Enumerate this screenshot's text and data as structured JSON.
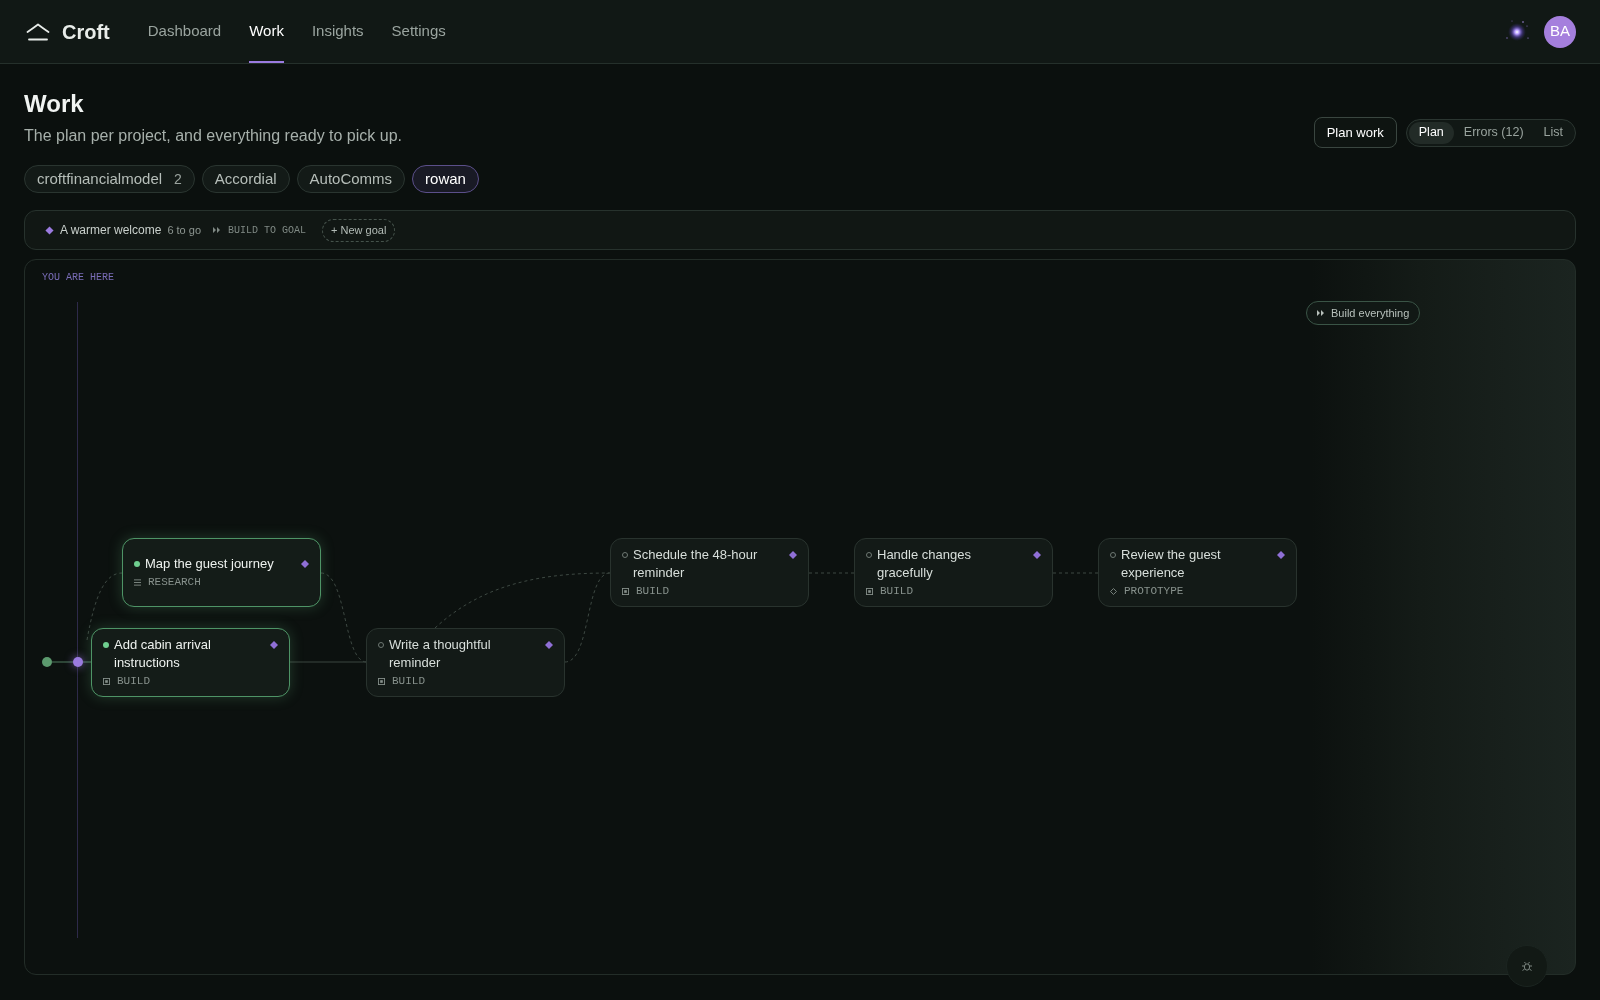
{
  "app": {
    "name": "Croft"
  },
  "nav": [
    {
      "label": "Dashboard",
      "selected": false
    },
    {
      "label": "Work",
      "selected": true
    },
    {
      "label": "Insights",
      "selected": false
    },
    {
      "label": "Settings",
      "selected": false
    }
  ],
  "user": {
    "initials": "BA"
  },
  "page": {
    "title": "Work",
    "subtitle": "The plan per project, and everything ready to pick up."
  },
  "actions": {
    "plan_button": "Plan work",
    "views": [
      {
        "label": "Plan",
        "selected": true
      },
      {
        "label": "Errors (12)",
        "selected": false
      },
      {
        "label": "List",
        "selected": false
      }
    ]
  },
  "projects": [
    {
      "name": "croftfinancialmodel",
      "count": "2",
      "selected": false
    },
    {
      "name": "Accordial",
      "selected": false
    },
    {
      "name": "AutoComms",
      "selected": false
    },
    {
      "name": "rowan",
      "selected": true
    }
  ],
  "goal_bar": {
    "goal": "A warmer welcome",
    "remaining": "6 to go",
    "build_action": "BUILD TO GOAL",
    "new_goal": "+ New goal"
  },
  "canvas": {
    "marker_label": "YOU ARE HERE",
    "build_all": "Build everything",
    "nodes": [
      {
        "title": "Map the guest journey",
        "kind": "research",
        "tag": "RESEARCH",
        "done": true
      },
      {
        "title": "Schedule the 48-hour reminder",
        "kind": "build",
        "tag": "BUILD",
        "done": false
      },
      {
        "title": "Handle changes gracefully",
        "kind": "build",
        "tag": "BUILD",
        "done": false
      },
      {
        "title": "Review the guest experience",
        "kind": "prototype",
        "tag": "PROTOTYPE",
        "done": false
      },
      {
        "title": "Add cabin arrival instructions",
        "kind": "build",
        "tag": "BUILD",
        "done": true
      },
      {
        "title": "Write a thoughtful reminder",
        "kind": "build",
        "tag": "BUILD",
        "done": false
      }
    ]
  }
}
